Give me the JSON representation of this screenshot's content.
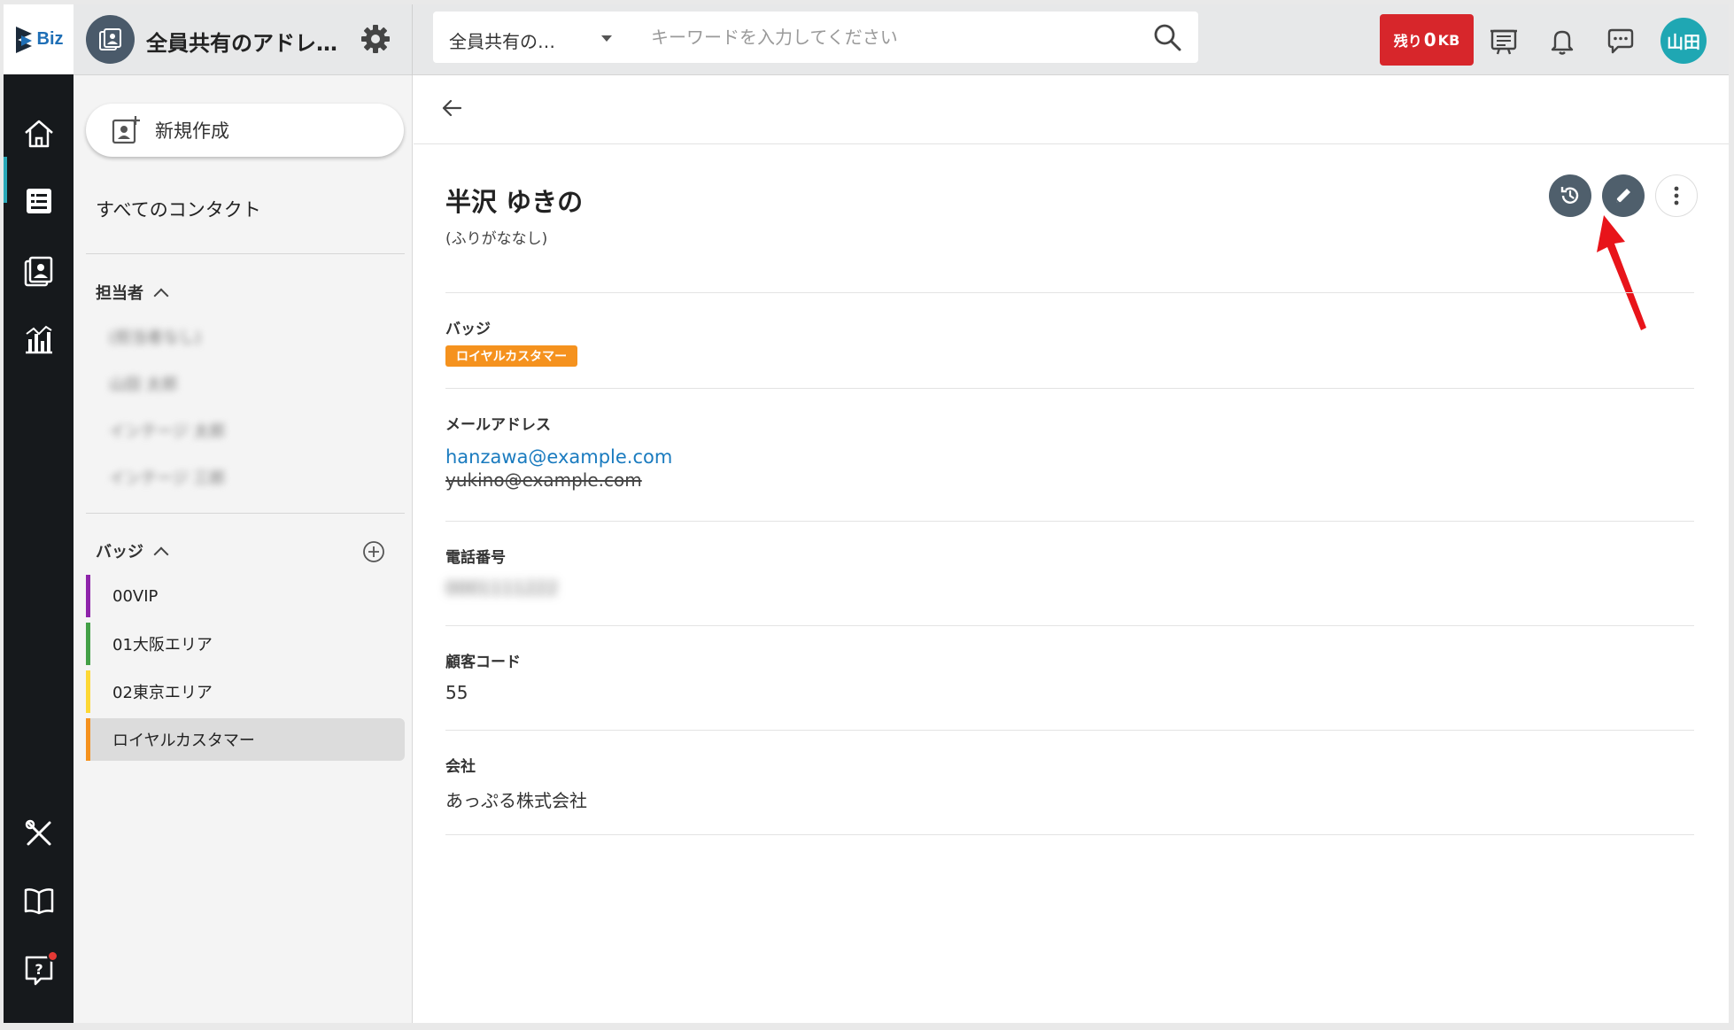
{
  "topbar": {
    "app_title": "全員共有のアドレ…",
    "scope_select": "全員共有の…",
    "search_placeholder": "キーワードを入力してください",
    "quota_prefix": "残り",
    "quota_value": "0",
    "quota_unit": "KB",
    "avatar_initials": "山田"
  },
  "logo": {
    "text": "Biz"
  },
  "sidebar": {
    "new_button": "新規作成",
    "all_contacts": "すべてのコンタクト",
    "owners_section": "担当者",
    "owners": [
      "(担当者なし)",
      "山田 太郎",
      "インテージ 太郎",
      "インテージ 三郎"
    ],
    "badges_section": "バッジ",
    "badges": [
      {
        "label": "00VIP",
        "color": "#8e24aa"
      },
      {
        "label": "01大阪エリア",
        "color": "#43a047"
      },
      {
        "label": "02東京エリア",
        "color": "#fdd835"
      },
      {
        "label": "ロイヤルカスタマー",
        "color": "#f5921e"
      }
    ]
  },
  "contact": {
    "name": "半沢 ゆきの",
    "kana": "(ふりがななし)",
    "badge_label": "バッジ",
    "badge_value": "ロイヤルカスタマー",
    "email_label": "メールアドレス",
    "email_primary": "hanzawa@example.com",
    "email_old": "yukino@example.com",
    "phone_label": "電話番号",
    "phone_value": "0001111222",
    "customer_code_label": "顧客コード",
    "customer_code_value": "55",
    "company_label": "会社",
    "company_value": "あっぷる株式会社"
  },
  "colors": {
    "accent": "#1fa7b3",
    "quota_bg": "#d7262b",
    "badge_orange": "#f5921e",
    "link": "#1a7bbf",
    "annotation_arrow": "#e8141a"
  }
}
